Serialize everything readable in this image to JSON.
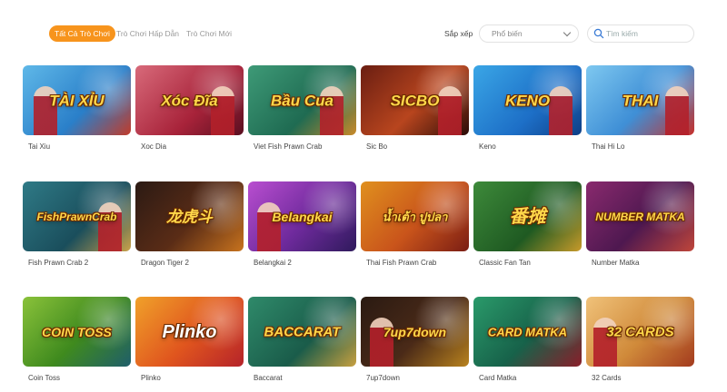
{
  "tabs": [
    {
      "label": "Tất Cả Trò Chơi",
      "active": true
    },
    {
      "label": "Trò Chơi Hấp Dẫn",
      "active": false
    },
    {
      "label": "Trò Chơi Mới",
      "active": false
    }
  ],
  "sort": {
    "label": "Sắp xếp",
    "selected": "Phổ biến"
  },
  "search": {
    "placeholder": "Tìm kiếm"
  },
  "colors": {
    "accent": "#f7941d"
  },
  "games": [
    {
      "name": "Tai Xiu",
      "art_text": "TÀI XỈU",
      "bg": "linear-gradient(135deg,#5fb8e8,#2a7fc9 60%,#c23b2a)",
      "icon": "tai-xiu-thumbnail"
    },
    {
      "name": "Xoc Dia",
      "art_text": "Xóc Đĩa",
      "bg": "linear-gradient(135deg,#d86a7a,#a8233a 60%,#5a0f20)",
      "icon": "xoc-dia-thumbnail"
    },
    {
      "name": "Viet Fish Prawn Crab",
      "art_text": "Bầu Cua",
      "bg": "linear-gradient(135deg,#3e9a77,#1f6b52 60%,#c98a2a)",
      "icon": "viet-fish-prawn-crab-thumbnail"
    },
    {
      "name": "Sic Bo",
      "art_text": "SICBO",
      "bg": "linear-gradient(135deg,#6a1e12,#b8451e 55%,#2a0c08)",
      "icon": "sic-bo-thumbnail"
    },
    {
      "name": "Keno",
      "art_text": "KENO",
      "bg": "linear-gradient(135deg,#3aa6e6,#1d6fc7 60%,#0e3f86)",
      "icon": "keno-thumbnail"
    },
    {
      "name": "Thai Hi Lo",
      "art_text": "THAI",
      "bg": "linear-gradient(135deg,#7ec8f0,#3f8fd6 55%,#c7302a)",
      "icon": "thai-hi-lo-thumbnail"
    },
    {
      "name": "Fish Prawn Crab 2",
      "art_text": "FishPrawnCrab",
      "bg": "linear-gradient(135deg,#2f7a86,#1a4e5c 60%,#caa24a)",
      "icon": "fish-prawn-crab-2-thumbnail"
    },
    {
      "name": "Dragon Tiger 2",
      "art_text": "龙虎斗",
      "bg": "linear-gradient(135deg,#2b1a14,#5a2c16 55%,#c8731e)",
      "icon": "dragon-tiger-2-thumbnail"
    },
    {
      "name": "Belangkai 2",
      "art_text": "Belangkai",
      "bg": "linear-gradient(135deg,#b94ed0,#6e2a9c 55%,#2f1a5c)",
      "icon": "belangkai-2-thumbnail"
    },
    {
      "name": "Thai Fish Prawn Crab",
      "art_text": "น้ำเต้า ปูปลา",
      "bg": "linear-gradient(135deg,#e0901e,#c9541b 55%,#7a1d14)",
      "icon": "thai-fish-prawn-crab-thumbnail"
    },
    {
      "name": "Classic Fan Tan",
      "art_text": "番摊",
      "bg": "linear-gradient(135deg,#3d8a3a,#1f5a22 60%,#c89a2a)",
      "icon": "classic-fan-tan-thumbnail"
    },
    {
      "name": "Number Matka",
      "art_text": "NUMBER MATKA",
      "bg": "linear-gradient(135deg,#8a2a6e,#4e1850 55%,#c0463a)",
      "icon": "number-matka-thumbnail"
    },
    {
      "name": "Coin Toss",
      "art_text": "COIN TOSS",
      "bg": "linear-gradient(135deg,#8ac23a,#3f8a1e 55%,#1f5e6a)",
      "icon": "coin-toss-thumbnail"
    },
    {
      "name": "Plinko",
      "art_text": "Plinko",
      "bg": "linear-gradient(135deg,#f0a12a,#e0551e 55%,#b5232a)",
      "icon": "plinko-thumbnail"
    },
    {
      "name": "Baccarat",
      "art_text": "BACCARAT",
      "bg": "linear-gradient(135deg,#2f8a6a,#1a5c4a 60%,#c8a040)",
      "icon": "baccarat-thumbnail"
    },
    {
      "name": "7up7down",
      "art_text": "7up7down",
      "bg": "linear-gradient(135deg,#2a1a12,#4a2a18 55%,#b8821e)",
      "icon": "7up7down-thumbnail"
    },
    {
      "name": "Card Matka",
      "art_text": "CARD MATKA",
      "bg": "linear-gradient(135deg,#2a9a6a,#17624a 55%,#8a1e2a)",
      "icon": "card-matka-thumbnail"
    },
    {
      "name": "32 Cards",
      "art_text": "32 CARDS",
      "bg": "linear-gradient(135deg,#f0c27a,#d08a3a 55%,#a33a1e)",
      "icon": "32-cards-thumbnail"
    }
  ]
}
